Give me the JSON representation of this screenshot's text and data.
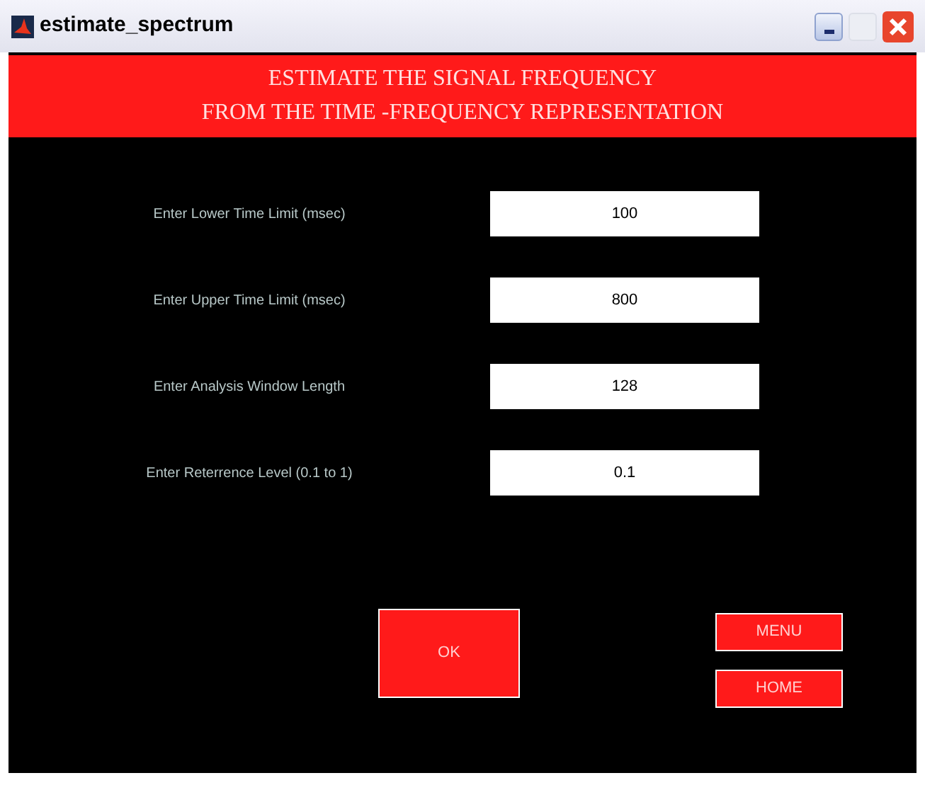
{
  "window": {
    "title": "estimate_spectrum"
  },
  "header": {
    "lines": [
      "ESTIMATE THE SIGNAL FREQUENCY",
      "FROM THE TIME -FREQUENCY REPRESENTATION"
    ]
  },
  "fields": [
    {
      "label": "Enter Lower Time Limit (msec)",
      "value": "100"
    },
    {
      "label": "Enter Upper Time Limit (msec)",
      "value": "800"
    },
    {
      "label": "Enter Analysis Window Length",
      "value": "128"
    },
    {
      "label": "Enter Reterrence Level (0.1 to 1)",
      "value": "0.1"
    }
  ],
  "buttons": {
    "ok": "OK",
    "menu": "MENU",
    "home": "HOME"
  }
}
